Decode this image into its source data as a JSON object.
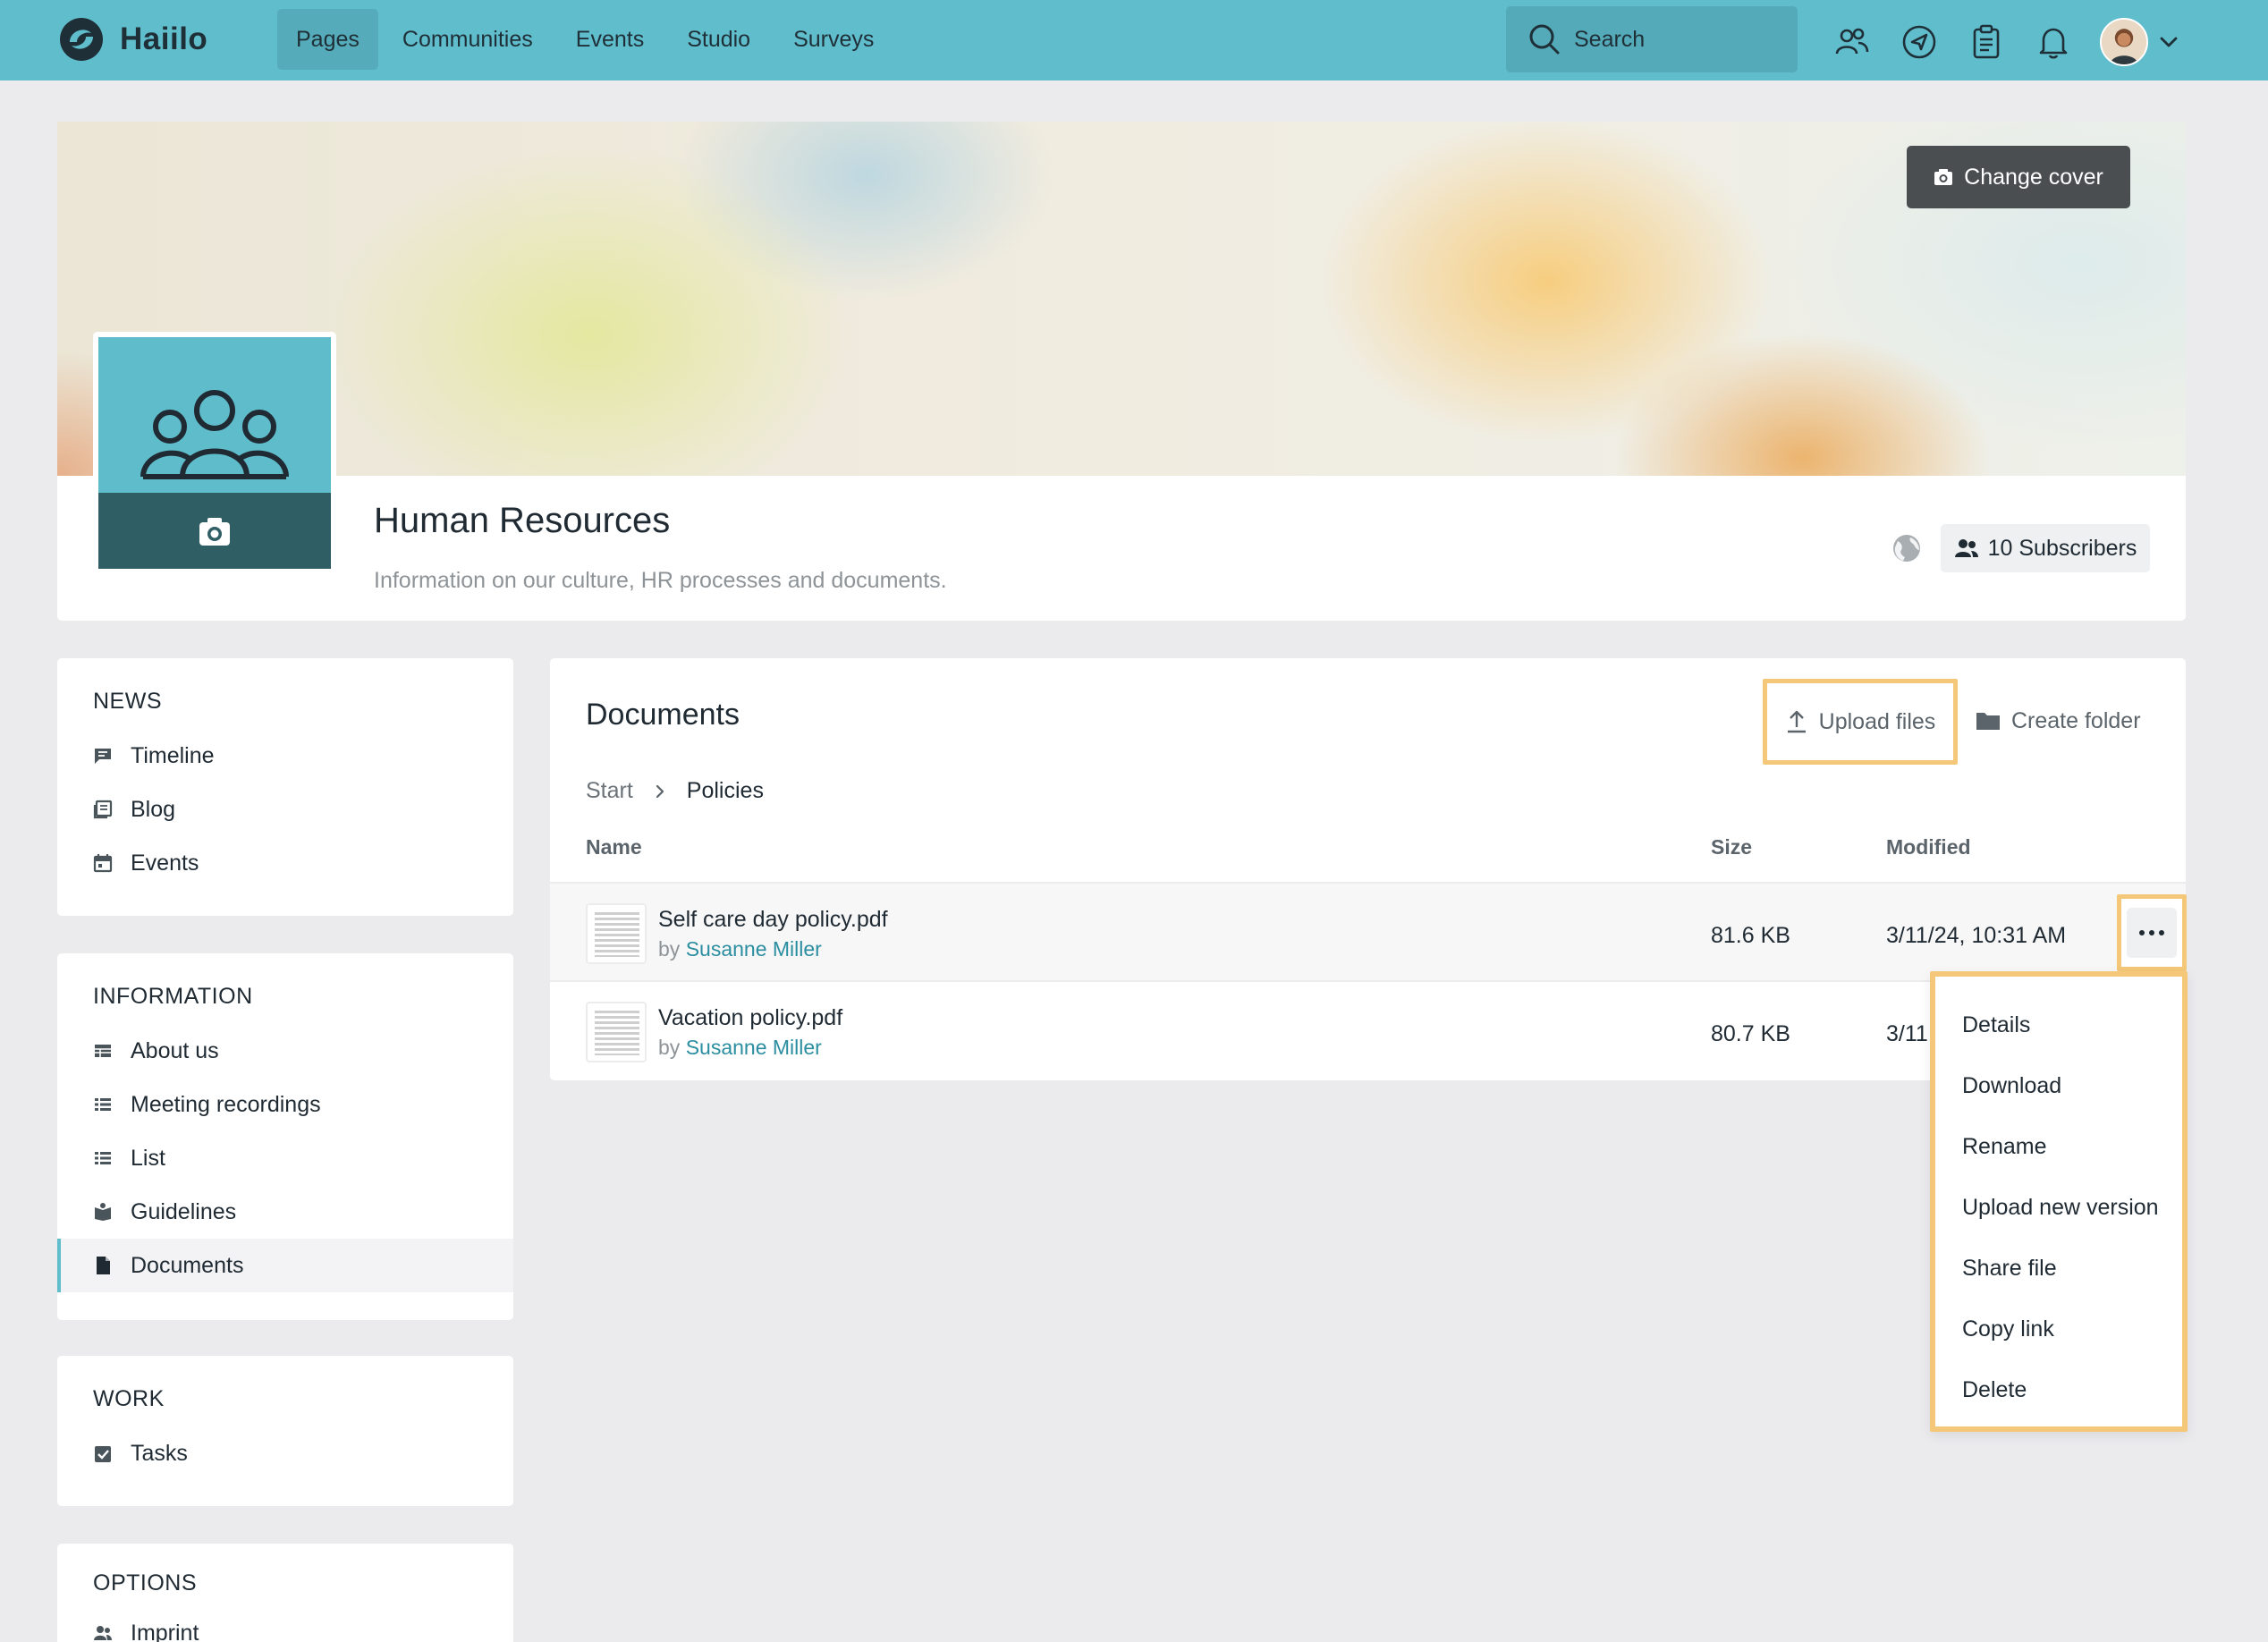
{
  "app": {
    "brand": "Haiilo",
    "nav": [
      "Pages",
      "Communities",
      "Events",
      "Studio",
      "Surveys"
    ],
    "active_nav": "Pages",
    "search_placeholder": "Search",
    "accent_color": "#60bdcc"
  },
  "cover": {
    "change_cover_label": "Change cover"
  },
  "page": {
    "title": "Human Resources",
    "description": "Information on our culture, HR processes and documents.",
    "subscribers_label": "10 Subscribers"
  },
  "sidebar": {
    "news": {
      "title": "NEWS",
      "items": [
        {
          "label": "Timeline",
          "icon": "timeline-icon"
        },
        {
          "label": "Blog",
          "icon": "blog-icon"
        },
        {
          "label": "Events",
          "icon": "calendar-icon"
        }
      ]
    },
    "information": {
      "title": "INFORMATION",
      "items": [
        {
          "label": "About us",
          "icon": "about-icon"
        },
        {
          "label": "Meeting recordings",
          "icon": "list-icon"
        },
        {
          "label": "List",
          "icon": "list-icon"
        },
        {
          "label": "Guidelines",
          "icon": "book-icon"
        },
        {
          "label": "Documents",
          "icon": "document-icon",
          "active": true
        }
      ]
    },
    "work": {
      "title": "WORK",
      "items": [
        {
          "label": "Tasks",
          "icon": "task-check-icon"
        }
      ]
    },
    "options": {
      "title": "OPTIONS",
      "items": [
        {
          "label": "Imprint",
          "icon": "people-icon"
        }
      ]
    }
  },
  "documents": {
    "title": "Documents",
    "upload_label": "Upload files",
    "create_folder_label": "Create folder",
    "breadcrumb": {
      "start": "Start",
      "current": "Policies"
    },
    "columns": {
      "name": "Name",
      "size": "Size",
      "modified": "Modified"
    },
    "files": [
      {
        "name": "Self care day policy.pdf",
        "by_prefix": "by",
        "author": "Susanne Miller",
        "size": "81.6 KB",
        "modified": "3/11/24, 10:31 AM"
      },
      {
        "name": "Vacation policy.pdf",
        "by_prefix": "by",
        "author": "Susanne Miller",
        "size": "80.7 KB",
        "modified": "3/11"
      }
    ]
  },
  "context_menu": {
    "items": [
      "Details",
      "Download",
      "Rename",
      "Upload new version",
      "Share file",
      "Copy link",
      "Delete"
    ]
  }
}
